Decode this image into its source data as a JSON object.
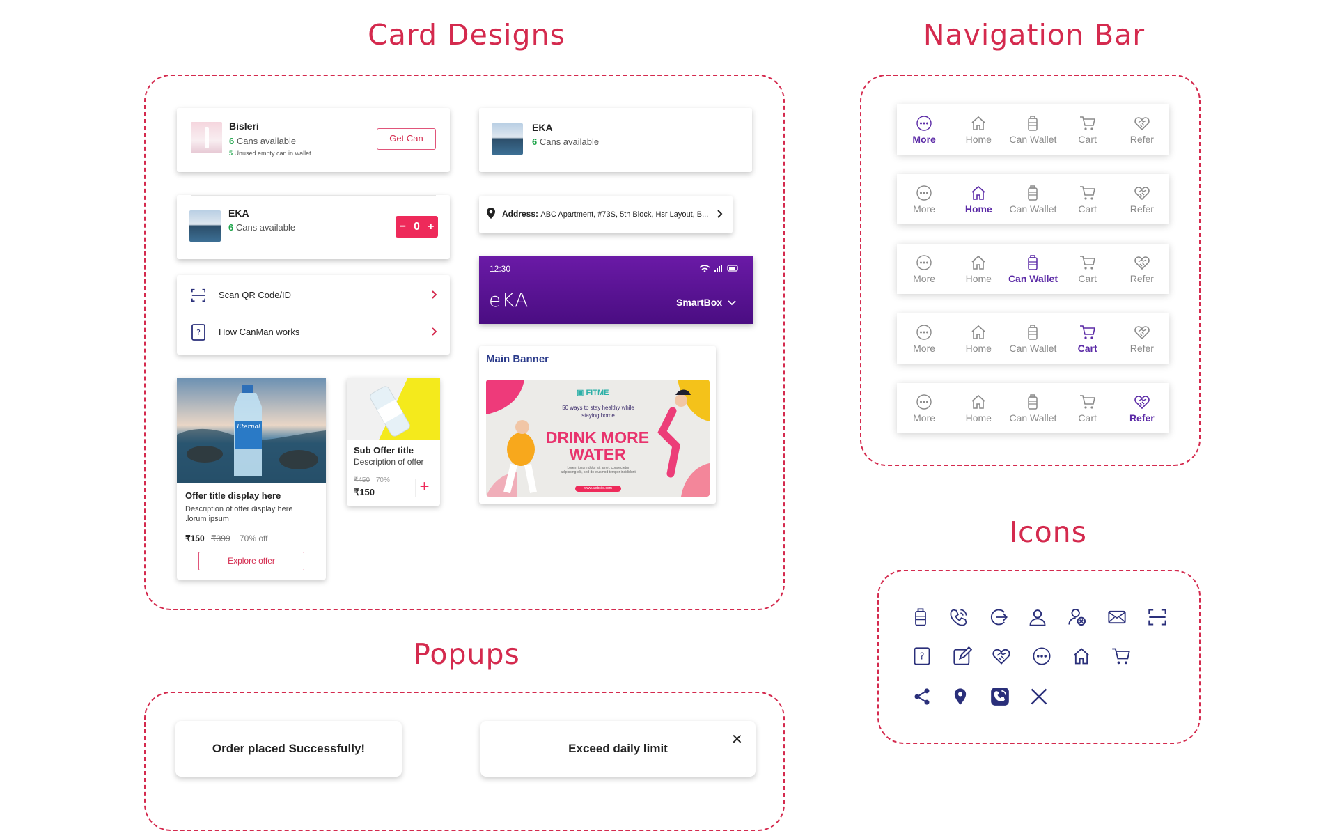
{
  "sections": {
    "cards_title": "Card Designs",
    "nav_title": "Navigation Bar",
    "icons_title": "Icons",
    "popups_title": "Popups"
  },
  "cards": {
    "bisleri": {
      "name": "Bisleri",
      "count": "6",
      "available": " Cans available",
      "unused_count": "5",
      "unused": " Unused empty can in wallet",
      "button": "Get Can"
    },
    "eka_top": {
      "name": "EKA",
      "count": "6",
      "available": " Cans available"
    },
    "eka_stepper": {
      "name": "EKA",
      "count": "6",
      "available": " Cans available",
      "minus": "−",
      "qty": "0",
      "plus": "+"
    },
    "address": {
      "label": "Address:",
      "value": "ABC Apartment, #73S, 5th Block, Hsr Layout, B..."
    },
    "menu": [
      {
        "label": "Scan QR Code/ID"
      },
      {
        "label": "How CanMan works"
      }
    ],
    "header": {
      "time": "12:30",
      "logo": "eKA",
      "selector": "SmartBox"
    },
    "banner": {
      "label": "Main Banner",
      "brand": "FITME",
      "tagline": "50 ways to stay healthy while staying home",
      "headline1": "DRINK MORE",
      "headline2": "WATER",
      "body": "Lorem ipsum dolor sit amet, consectetur adipiscing elit, sed do eiusmod tempor incididunt",
      "url": "www.website.com"
    },
    "offer": {
      "brand": "Eternal",
      "title": "Offer title display here",
      "desc": "Description of offer display here .lorum ipsum",
      "price": "₹150",
      "old_price": "₹399",
      "off": "70% off",
      "button": "Explore offer"
    },
    "sub_offer": {
      "title": "Sub Offer title",
      "desc": "Description of offer",
      "old_price": "₹450",
      "off": "70%",
      "price": "₹150",
      "add": "+"
    }
  },
  "nav": {
    "labels": [
      "More",
      "Home",
      "Can Wallet",
      "Cart",
      "Refer"
    ],
    "active_color": "#5b2aa6",
    "inactive_color": "#8a8a8a"
  },
  "icons": [
    "can-icon",
    "phone-call-icon",
    "logout-icon",
    "user-icon",
    "user-remove-icon",
    "mail-icon",
    "scan-icon",
    "help-book-icon",
    "edit-icon",
    "refer-handshake-icon",
    "more-dots-icon",
    "home-icon",
    "cart-icon",
    "share-icon",
    "location-pin-icon",
    "viber-phone-icon",
    "close-icon"
  ],
  "popups": {
    "success": "Order placed Successfully!",
    "limit": "Exceed daily limit",
    "close": "✕"
  },
  "colors": {
    "accent": "#d42a4e",
    "brand_purple": "#5b1a9a",
    "success_green": "#1ea44a",
    "icon_navy": "#2a2f7a"
  }
}
